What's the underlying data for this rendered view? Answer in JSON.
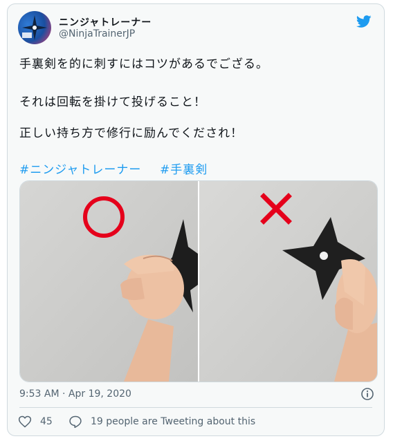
{
  "tweet": {
    "display_name": "ニンジャトレーナー",
    "handle": "@NinjaTrainerJP",
    "lines": [
      "手裏剣を的に刺すにはコツがあるでござる。",
      "それは回転を掛けて投げること！",
      "正しい持ち方で修行に励んでくだされ！"
    ],
    "hashtags": [
      "#ニンジャトレーナー",
      "#手裏剣"
    ],
    "timestamp": "9:53 AM · Apr 19, 2020",
    "likes": "45",
    "replies_text": "19 people are Tweeting about this"
  },
  "colors": {
    "link": "#1d9bf0",
    "twitter_blue": "#1d9bf0",
    "correct_mark": "#e5001b",
    "wrong_mark": "#e5001b"
  },
  "icons": [
    "twitter-bird-icon",
    "info-icon",
    "heart-icon",
    "speech-bubble-icon"
  ],
  "media": {
    "left_mark": "○",
    "right_mark": "×"
  }
}
